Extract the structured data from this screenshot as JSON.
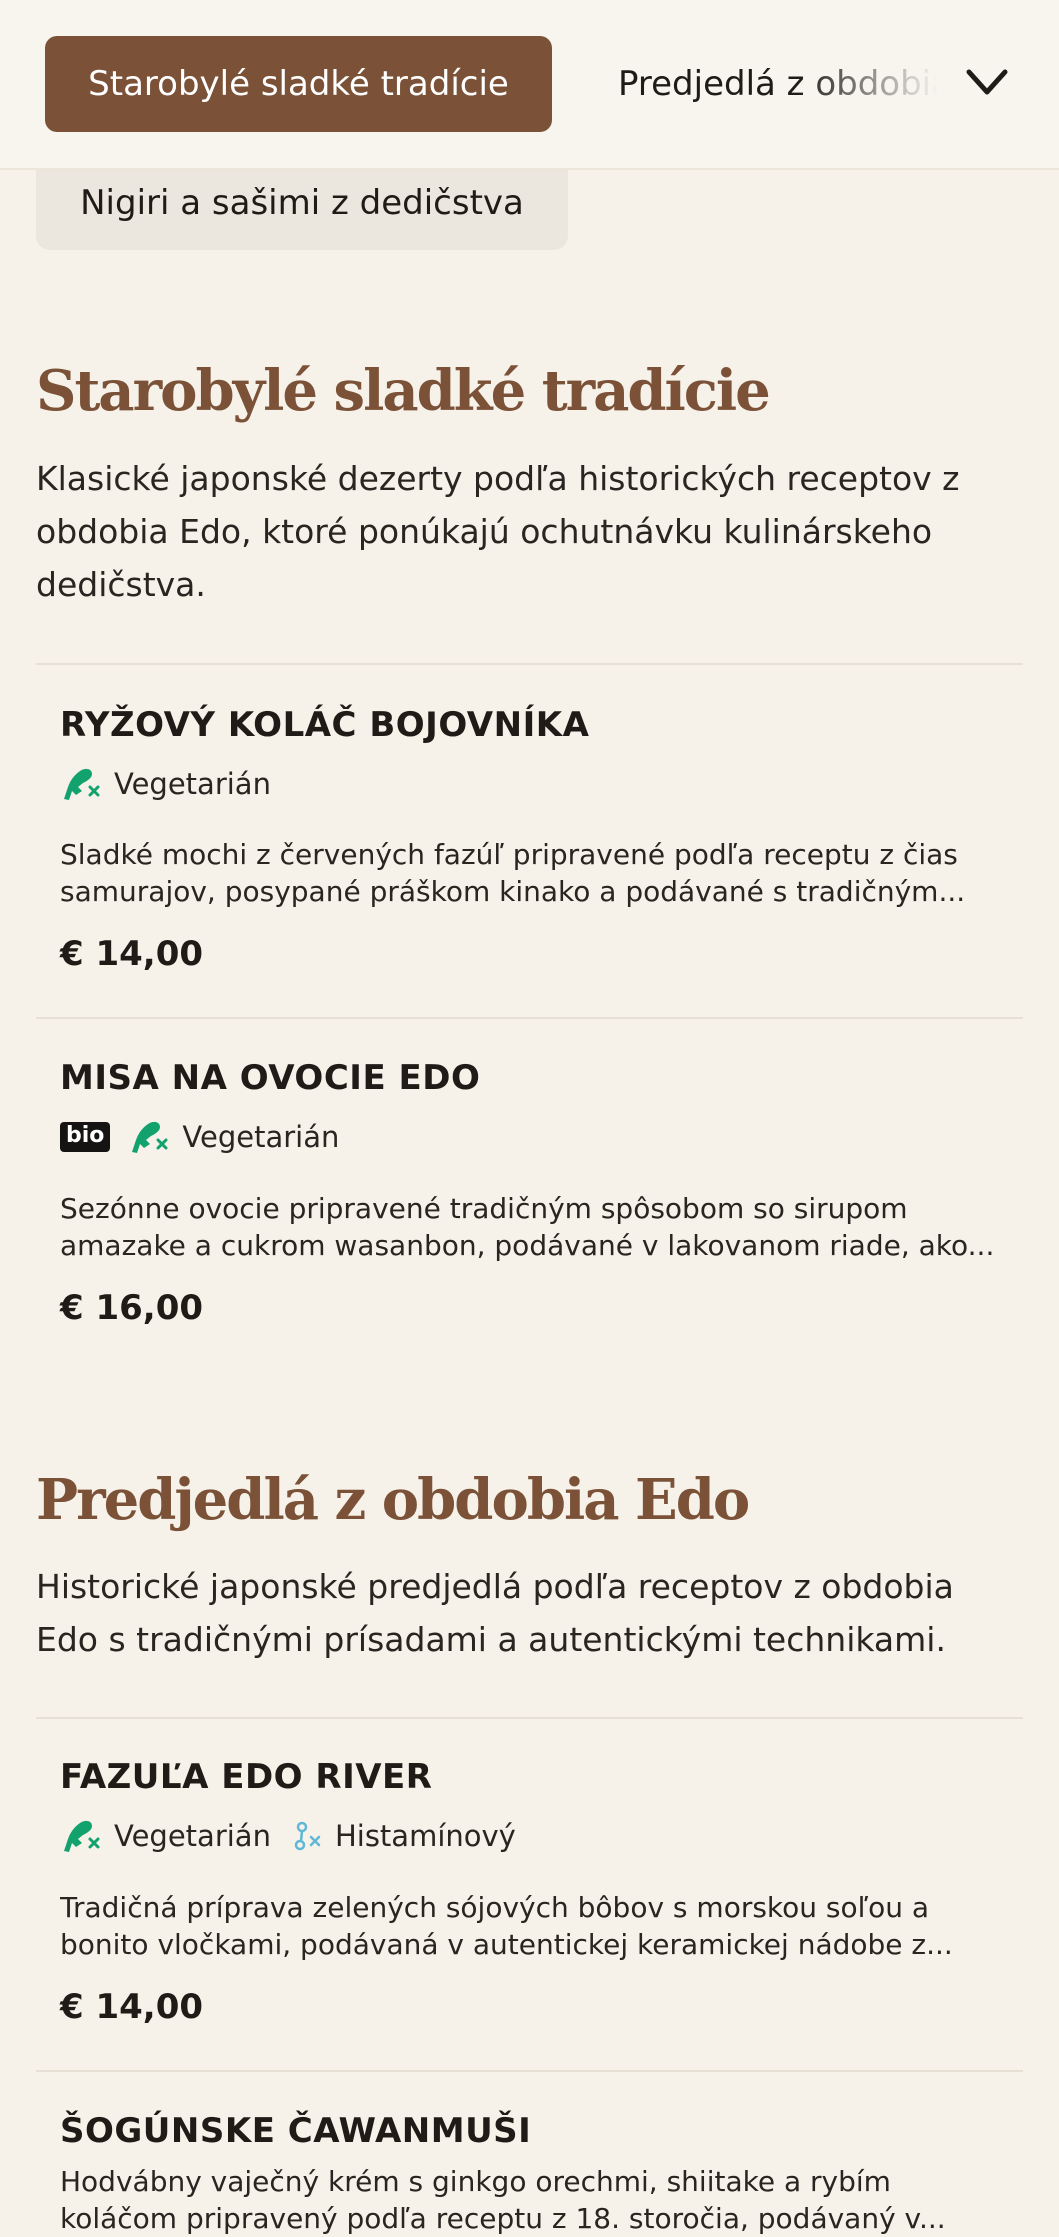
{
  "nav": {
    "active_category": "Starobylé sladké tradície",
    "next_category": "Predjedlá z obdobia Edo",
    "subcategory": "Nigiri a sašimi z dedičstva",
    "accent_color": "#7b5238"
  },
  "sections": [
    {
      "title": "Starobylé sladké tradície",
      "description": "Klasické japonské dezerty podľa historických receptov z obdobia Edo, ktoré ponúkajú ochutnávku kulinárskeho dedičstva.",
      "items": [
        {
          "name": "RYŽOVÝ KOLÁČ BOJOVNÍKA",
          "tags": [
            "Vegetarián"
          ],
          "description_line1": "Sladké mochi z červených fazúľ pripravené podľa receptu z čias",
          "description_line2": "samurajov, posypané práškom kinako a podávané s tradičným...",
          "price": "€ 14,00"
        },
        {
          "name": "MISA NA OVOCIE EDO",
          "badge": "bio",
          "tags": [
            "Vegetarián"
          ],
          "description_line1": "Sezónne ovocie pripravené tradičným spôsobom so sirupom",
          "description_line2": "amazake a cukrom wasanbon, podávané v lakovanom riade, ako...",
          "price": "€ 16,00"
        }
      ]
    },
    {
      "title": "Predjedlá z obdobia Edo",
      "description": "Historické japonské predjedlá podľa receptov z obdobia Edo s tradičnými prísadami a autentickými technikami.",
      "items": [
        {
          "name": "FAZUĽA EDO RIVER",
          "tags": [
            "Vegetarián",
            "Histamínový"
          ],
          "description_line1": "Tradičná príprava zelených sójových bôbov s morskou soľou a",
          "description_line2": "bonito vločkami, podávaná v autentickej keramickej nádobe z...",
          "price": "€ 14,00"
        },
        {
          "name": "ŠOGÚNSKE ČAWANMUŠI",
          "description_line1": "Hodvábny vaječný krém s ginkgo orechmi, shiitake a rybím",
          "description_line2": "koláčom pripravený podľa receptu z 18. storočia, podávaný v..."
        }
      ]
    }
  ],
  "icons": {
    "vegetarian": "leg-crossed-icon",
    "histamine": "molecule-crossed-icon",
    "chevron": "chevron-down-icon"
  }
}
